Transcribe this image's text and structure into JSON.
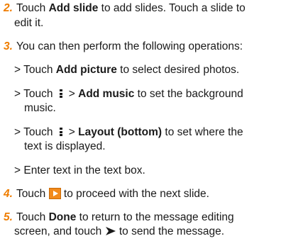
{
  "steps": [
    {
      "num": "2.",
      "line1": {
        "pre": "Touch ",
        "bold": "Add slide",
        "post": " to add slides. Touch a slide to"
      },
      "line2": "edit it."
    },
    {
      "num": "3.",
      "line1": "You can then perform the following operations:"
    },
    {
      "sub1": {
        "pre": "> Touch ",
        "bold": "Add picture",
        "post": " to select desired photos."
      }
    },
    {
      "sub2": {
        "pre": "> Touch",
        "mid": " > ",
        "bold": "Add music",
        "post": " to set the background",
        "line2": "music."
      }
    },
    {
      "sub3": {
        "pre": "> Touch",
        "mid": " > ",
        "bold": "Layout (bottom)",
        "post": " to set where the",
        "line2": "text is displayed."
      }
    },
    {
      "sub4": "> Enter text in the text box."
    },
    {
      "num": "4.",
      "pre": "Touch ",
      "post": " to proceed with the next slide."
    },
    {
      "num": "5.",
      "line1": {
        "pre": "Touch ",
        "bold": "Done",
        "post": " to return to the message editing"
      },
      "line2": {
        "pre": "screen, and touch ",
        "post": " to send the message."
      }
    }
  ],
  "icons": {
    "menu": "menu-dots-icon",
    "next": "next-slide-icon",
    "send": "send-icon"
  },
  "colors": {
    "accent": "#ef7d00",
    "text": "#1a1a1a",
    "next_icon": "#f28a1c"
  }
}
